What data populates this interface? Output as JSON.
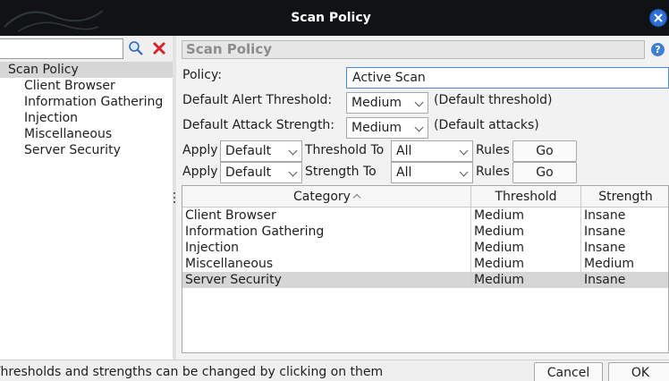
{
  "window": {
    "title": "Scan Policy"
  },
  "tree": {
    "root": "Scan Policy",
    "children": [
      "Client Browser",
      "Information Gathering",
      "Injection",
      "Miscellaneous",
      "Server Security"
    ]
  },
  "panel": {
    "header": "Scan Policy",
    "help": "?",
    "policy_label": "Policy:",
    "policy_value": "Active Scan",
    "alert_threshold_label": "Default Alert Threshold:",
    "alert_threshold_value": "Medium",
    "alert_threshold_note": "(Default threshold)",
    "attack_strength_label": "Default Attack Strength:",
    "attack_strength_value": "Medium",
    "attack_strength_note": "(Default attacks)",
    "apply_threshold": {
      "apply": "Apply",
      "value": "Default",
      "to": "Threshold To",
      "scope": "All",
      "rules": "Rules",
      "go": "Go"
    },
    "apply_strength": {
      "apply": "Apply",
      "value": "Default",
      "to": "Strength To",
      "scope": "All",
      "rules": "Rules",
      "go": "Go"
    }
  },
  "table": {
    "headers": {
      "category": "Category",
      "threshold": "Threshold",
      "strength": "Strength"
    },
    "rows": [
      {
        "category": "Client Browser",
        "threshold": "Medium",
        "strength": "Insane"
      },
      {
        "category": "Information Gathering",
        "threshold": "Medium",
        "strength": "Insane"
      },
      {
        "category": "Injection",
        "threshold": "Medium",
        "strength": "Insane"
      },
      {
        "category": "Miscellaneous",
        "threshold": "Medium",
        "strength": "Medium"
      },
      {
        "category": "Server Security",
        "threshold": "Medium",
        "strength": "Insane",
        "selected": true
      }
    ]
  },
  "footer": {
    "hint": "Thresholds and strengths can be changed by clicking on them",
    "cancel": "Cancel",
    "ok": "OK"
  },
  "colors": {
    "titlebar": "#101215",
    "close": "#2e6fd6",
    "selection": "#d6d6d6",
    "focus": "#4f88d2"
  }
}
